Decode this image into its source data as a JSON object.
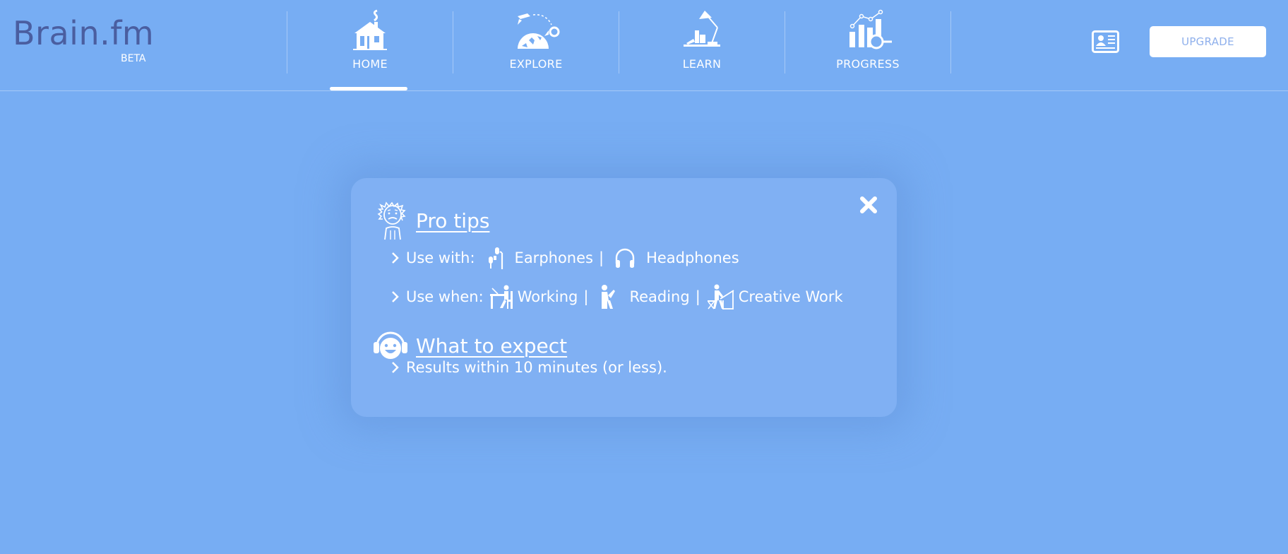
{
  "brand": {
    "name": "Brain.fm",
    "badge": "BETA"
  },
  "nav": {
    "items": [
      {
        "label": "HOME",
        "icon": "house-icon",
        "active": true
      },
      {
        "label": "EXPLORE",
        "icon": "rocket-globe-icon",
        "active": false
      },
      {
        "label": "LEARN",
        "icon": "desk-lamp-icon",
        "active": false
      },
      {
        "label": "PROGRESS",
        "icon": "chart-magnifier-icon",
        "active": false
      }
    ]
  },
  "header": {
    "profile_icon": "id-card-icon",
    "upgrade_label": "UPGRADE"
  },
  "colors": {
    "background": "#77adf3",
    "card": "#80b0f3",
    "logo": "#4a5ea0",
    "upgrade_text": "#8fb0ec"
  },
  "card": {
    "close_icon": "close-icon",
    "pro_tips": {
      "title": "Pro tips",
      "icon": "einstein-icon",
      "use_with": {
        "label": "Use with:",
        "items": [
          {
            "label": "Earphones",
            "icon": "earphones-icon",
            "separator": "|"
          },
          {
            "label": "Headphones",
            "icon": "headphones-icon",
            "separator": ""
          }
        ]
      },
      "use_when": {
        "label": "Use when:",
        "items": [
          {
            "label": "Working",
            "icon": "working-person-icon",
            "separator": "|"
          },
          {
            "label": "Reading",
            "icon": "reading-person-icon",
            "separator": "|"
          },
          {
            "label": "Creative Work",
            "icon": "drawing-person-icon",
            "separator": ""
          }
        ]
      }
    },
    "what_to_expect": {
      "title": "What to expect",
      "icon": "smiley-headphones-icon",
      "text": "Results within 10 minutes (or less)."
    }
  }
}
